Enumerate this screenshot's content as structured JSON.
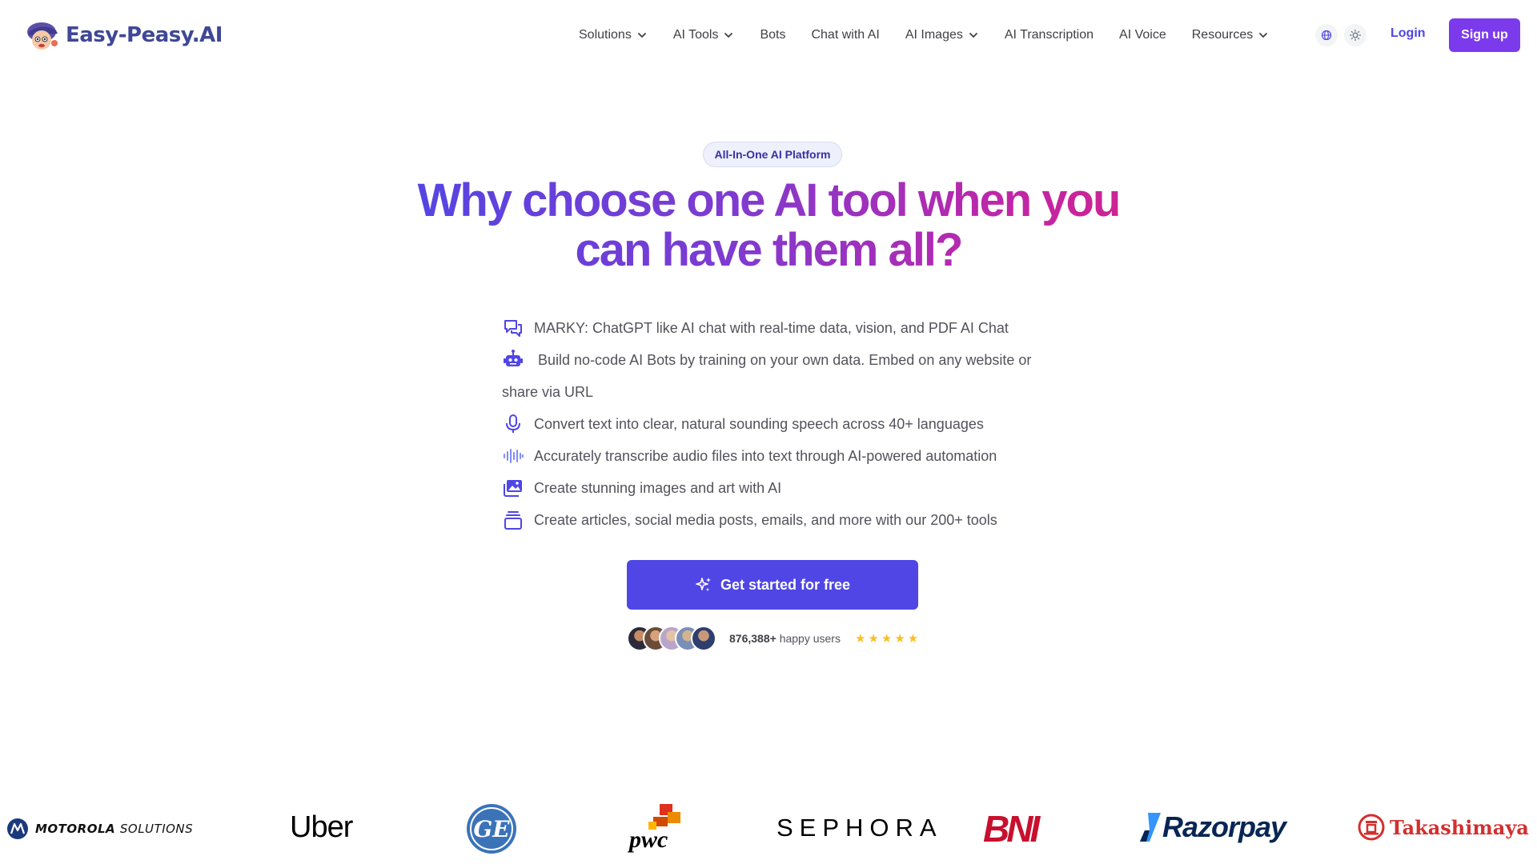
{
  "brand": {
    "name": "Easy-Peasy.AI"
  },
  "nav": {
    "items": [
      {
        "label": "Solutions",
        "has_dropdown": true
      },
      {
        "label": "AI Tools",
        "has_dropdown": true
      },
      {
        "label": "Bots",
        "has_dropdown": false
      },
      {
        "label": "Chat with AI",
        "has_dropdown": false
      },
      {
        "label": "AI Images",
        "has_dropdown": true
      },
      {
        "label": "AI Transcription",
        "has_dropdown": false
      },
      {
        "label": "AI Voice",
        "has_dropdown": false
      },
      {
        "label": "Resources",
        "has_dropdown": true
      }
    ],
    "login_label": "Login",
    "signup_label": "Sign up",
    "icons": [
      "globe-icon",
      "sun-icon"
    ]
  },
  "hero": {
    "badge": "All-In-One AI Platform",
    "headline_line1": "Why choose one AI tool when you",
    "headline_line2": "can have them all?",
    "features": [
      {
        "icon": "chat-bubbles-icon",
        "text": "MARKY: ChatGPT like AI chat with real-time data, vision, and PDF AI Chat"
      },
      {
        "icon": "robot-icon",
        "text": "Build no-code AI Bots by training on your own data. Embed on any website or share via URL"
      },
      {
        "icon": "microphone-icon",
        "text": "Convert text into clear, natural sounding speech across 40+ languages"
      },
      {
        "icon": "waveform-icon",
        "text": "Accurately transcribe audio files into text through AI-powered automation"
      },
      {
        "icon": "images-icon",
        "text": "Create stunning images and art with AI"
      },
      {
        "icon": "stack-icon",
        "text": "Create articles, social media posts, emails, and more with our 200+ tools"
      }
    ],
    "cta_label": "Get started for free",
    "users_count": "876,388+",
    "users_suffix": "happy users",
    "rating_stars": 5
  },
  "colors": {
    "primary": "#4f46e5",
    "signup": "#7c3aed",
    "gradient_start": "#4f46e5",
    "gradient_end": "#d32389",
    "star": "#fbbf24"
  },
  "customers": {
    "motorola_bold": "MOTOROLA",
    "motorola_rest": "SOLUTIONS",
    "uber": "Uber",
    "ge": "GE",
    "pwc": "pwc",
    "sephora": "SEPHORA",
    "bni": "BNI",
    "razorpay": "Razorpay",
    "takashimaya": "Takashimaya"
  }
}
